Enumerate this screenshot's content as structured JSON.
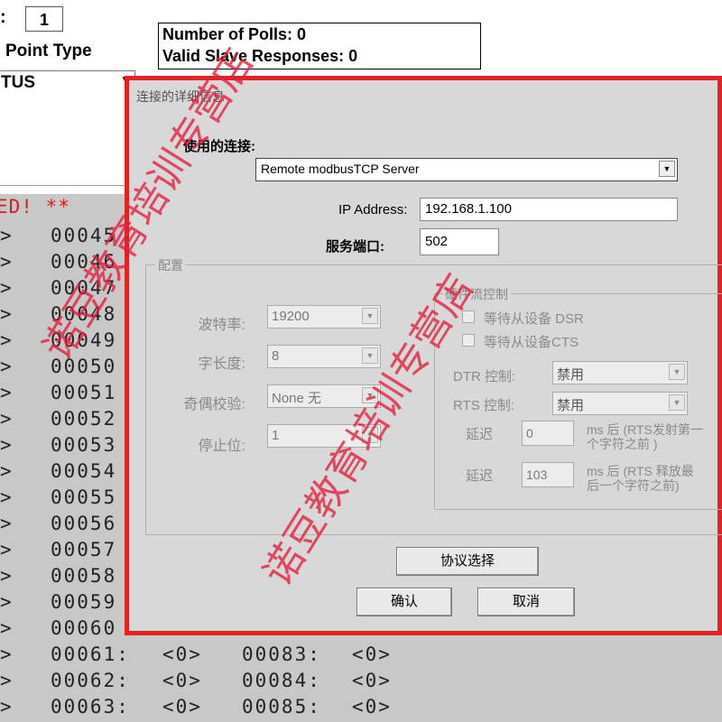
{
  "background": {
    "address_label": ":",
    "address_value": "1",
    "point_type_label": "Point Type",
    "point_type_value": "TUS",
    "stats": {
      "polls": "Number of Polls: 0",
      "valid": "Valid Slave Responses: 0"
    },
    "error_text": "ED!  **",
    "rows": [
      {
        "c1": ">",
        "c2": "00045",
        "c3": "",
        "c4": "",
        "c5": ""
      },
      {
        "c1": ">",
        "c2": "00046",
        "c3": "",
        "c4": "",
        "c5": ""
      },
      {
        "c1": ">",
        "c2": "00047",
        "c3": "",
        "c4": "",
        "c5": ""
      },
      {
        "c1": ">",
        "c2": "00048",
        "c3": "",
        "c4": "",
        "c5": ""
      },
      {
        "c1": ">",
        "c2": "00049",
        "c3": "",
        "c4": "",
        "c5": ""
      },
      {
        "c1": ">",
        "c2": "00050",
        "c3": "",
        "c4": "",
        "c5": ""
      },
      {
        "c1": ">",
        "c2": "00051",
        "c3": "",
        "c4": "",
        "c5": ""
      },
      {
        "c1": ">",
        "c2": "00052",
        "c3": "",
        "c4": "",
        "c5": ""
      },
      {
        "c1": ">",
        "c2": "00053",
        "c3": "",
        "c4": "",
        "c5": ""
      },
      {
        "c1": ">",
        "c2": "00054",
        "c3": "",
        "c4": "",
        "c5": ""
      },
      {
        "c1": ">",
        "c2": "00055",
        "c3": "",
        "c4": "",
        "c5": ""
      },
      {
        "c1": ">",
        "c2": "00056",
        "c3": "",
        "c4": "",
        "c5": ""
      },
      {
        "c1": ">",
        "c2": "00057",
        "c3": "",
        "c4": "",
        "c5": ""
      },
      {
        "c1": ">",
        "c2": "00058",
        "c3": "",
        "c4": "",
        "c5": ""
      },
      {
        "c1": ">",
        "c2": "00059",
        "c3": "",
        "c4": "",
        "c5": ""
      },
      {
        "c1": ">",
        "c2": "00060",
        "c3": "",
        "c4": "",
        "c5": ""
      },
      {
        "c1": ">",
        "c2": "00061:",
        "c3": "<0>",
        "c4": "00083:",
        "c5": "<0>"
      },
      {
        "c1": ">",
        "c2": "00062:",
        "c3": "<0>",
        "c4": "00084:",
        "c5": "<0>"
      },
      {
        "c1": ">",
        "c2": "00063:",
        "c3": "<0>",
        "c4": "00085:",
        "c5": "<0>"
      }
    ]
  },
  "dialog": {
    "title": "连接的详细信息",
    "connection_label": "使用的连接:",
    "connection_value": "Remote modbusTCP Server",
    "ip_label": "IP Address:",
    "ip_value": "192.168.1.100",
    "port_label": "服务端口:",
    "port_value": "502",
    "config": {
      "legend": "配置",
      "baud_label": "波特率:",
      "baud_value": "19200",
      "wordlen_label": "字长度:",
      "wordlen_value": "8",
      "parity_label": "奇偶校验:",
      "parity_value": "None 无",
      "stop_label": "停止位:",
      "stop_value": "1"
    },
    "hardware": {
      "legend": "硬件流控制",
      "dsr_label": "等待从设备 DSR",
      "cts_label": "等待从设备CTS",
      "dtr_label": "DTR 控制:",
      "dtr_value": "禁用",
      "rts_label": "RTS 控制:",
      "rts_value": "禁用",
      "delay1_label": "延迟",
      "delay1_value": "0",
      "delay1_note_line1": "ms 后 (RTS发射第一",
      "delay1_note_line2": "个字符之前 )",
      "delay2_label": "延迟",
      "delay2_value": "103",
      "delay2_note_line1": "ms 后 (RTS 释放最",
      "delay2_note_line2": "后一个字符之前)"
    },
    "protocol_button": "协议选择",
    "ok_button": "确认",
    "cancel_button": "取消"
  },
  "watermark": {
    "text_1": "诺豆教育培训专营店",
    "text_2": "诺豆教育培训专营店"
  },
  "colors": {
    "dialog_border": "#e02424",
    "watermark": "#e11e3c",
    "error_text": "#d02020",
    "data_background": "#c8c8c8"
  }
}
